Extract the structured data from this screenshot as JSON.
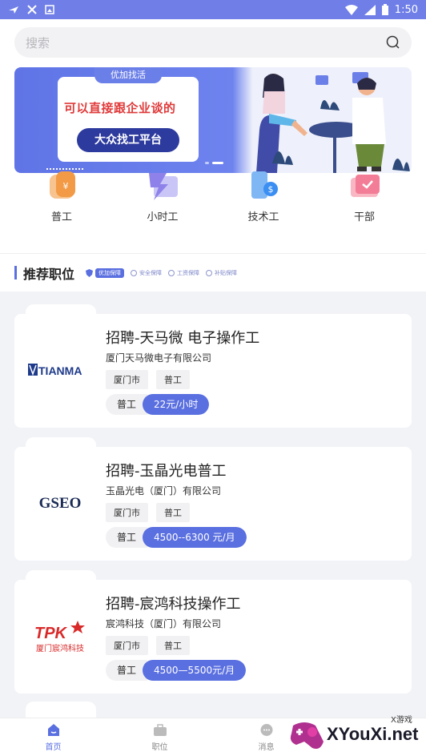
{
  "search": {
    "placeholder": "搜索"
  },
  "banner": {
    "tab": "优加找活",
    "slogan": "可以直接跟企业谈的",
    "button": "大众找工平台"
  },
  "categories": [
    {
      "label": "普工",
      "icon": "money-bag-icon"
    },
    {
      "label": "小时工",
      "icon": "lightning-icon"
    },
    {
      "label": "技术工",
      "icon": "phone-dollar-icon"
    },
    {
      "label": "干部",
      "icon": "briefcase-icon"
    }
  ],
  "section": {
    "title": "推荐职位",
    "badges": [
      "优加保障",
      "安全保障",
      "工资保障",
      "补贴保障"
    ]
  },
  "jobs": [
    {
      "title": "招聘-天马微 电子操作工",
      "company": "厦门天马微电子有限公司",
      "tags": [
        "厦门市",
        "普工"
      ],
      "type": "普工",
      "pay": "22元/小时",
      "logo": "TIANMA"
    },
    {
      "title": "招聘-玉晶光电普工",
      "company": "玉晶光电（厦门）有限公司",
      "tags": [
        "厦门市",
        "普工"
      ],
      "type": "普工",
      "pay": "4500--6300 元/月",
      "logo": "GSEO"
    },
    {
      "title": "招聘-宸鸿科技操作工",
      "company": "宸鸿科技（厦门）有限公司",
      "tags": [
        "厦门市",
        "普工"
      ],
      "type": "普工",
      "pay": "4500—5500元/月",
      "logo": "TPK",
      "logo_sub": "厦门宸鸿科技"
    }
  ],
  "tabbar": {
    "home": "首页",
    "jobs": "职位",
    "messages": "消息"
  },
  "status": {
    "time": "1:50"
  },
  "watermark": {
    "brand": "XYouXi.net",
    "badge": "X游戏"
  },
  "colors": {
    "accent": "#5a6fe0",
    "status_bar": "#6f7fe7"
  }
}
